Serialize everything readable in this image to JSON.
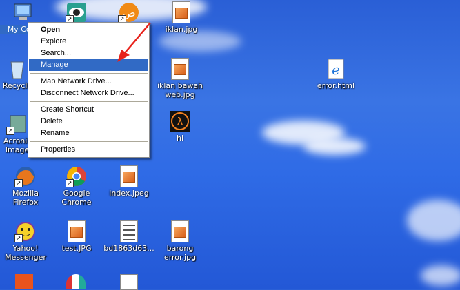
{
  "desktop_icons": [
    {
      "label": "My Computer",
      "display": "My Com",
      "icon": "computer-icon"
    },
    {
      "label": "",
      "icon": "eye-app-icon"
    },
    {
      "label": "",
      "icon": "arabic-app-icon"
    },
    {
      "label": "iklan.jpg",
      "icon": "jpg-file-icon"
    },
    {
      "label": "Recycle",
      "icon": "recycle-bin-icon"
    },
    {
      "label": "iklan bawah web.jpg",
      "line1": "iklan bawah",
      "line2": "web.jpg",
      "icon": "jpg-file-icon"
    },
    {
      "label": "error.html",
      "icon": "ie-html-icon"
    },
    {
      "label": "Acronis Image",
      "line1": "Acronis",
      "line2": "Image",
      "icon": "acronis-icon"
    },
    {
      "label": "hl",
      "icon": "half-life-icon"
    },
    {
      "label": "Mozilla Firefox",
      "icon": "firefox-icon"
    },
    {
      "label": "Google Chrome",
      "line1": "Google",
      "line2": "Chrome",
      "icon": "chrome-icon"
    },
    {
      "label": "index.jpeg",
      "icon": "jpg-file-icon"
    },
    {
      "label": "Yahoo! Messenger",
      "line1": "Yahoo!",
      "line2": "Messenger",
      "icon": "yahoo-messenger-icon"
    },
    {
      "label": "test.JPG",
      "icon": "jpg-file-icon"
    },
    {
      "label": "bd1863d63...",
      "icon": "document-file-icon"
    },
    {
      "label": "barong error.jpg",
      "line1": "barong",
      "line2": "error.jpg",
      "icon": "jpg-file-icon"
    }
  ],
  "context_menu": {
    "open": "Open",
    "explore": "Explore",
    "search": "Search...",
    "manage": "Manage",
    "map_network_drive": "Map Network Drive...",
    "disconnect_network_drive": "Disconnect Network Drive...",
    "create_shortcut": "Create Shortcut",
    "delete": "Delete",
    "rename": "Rename",
    "properties": "Properties",
    "highlighted": "Manage"
  },
  "colors": {
    "highlight": "#316ac5",
    "annotation_arrow": "#e8221b"
  }
}
